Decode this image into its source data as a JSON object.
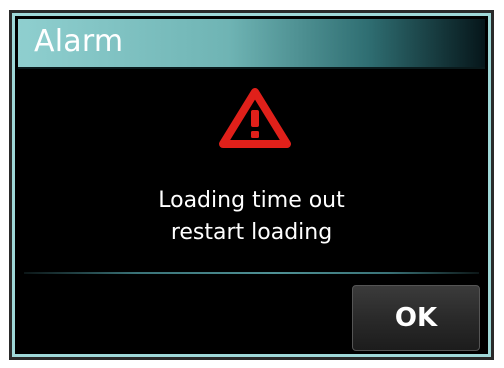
{
  "dialog": {
    "title": "Alarm",
    "icon": "warning-triangle-icon",
    "message_lines": [
      "Loading time out",
      "restart loading"
    ],
    "ok_label": "OK"
  },
  "colors": {
    "title_bar_start": "#8fcfcf",
    "title_bar_end": "#06161a",
    "frame_accent": "#9fd8d8",
    "warning_red": "#e0201a",
    "background": "#000000"
  }
}
